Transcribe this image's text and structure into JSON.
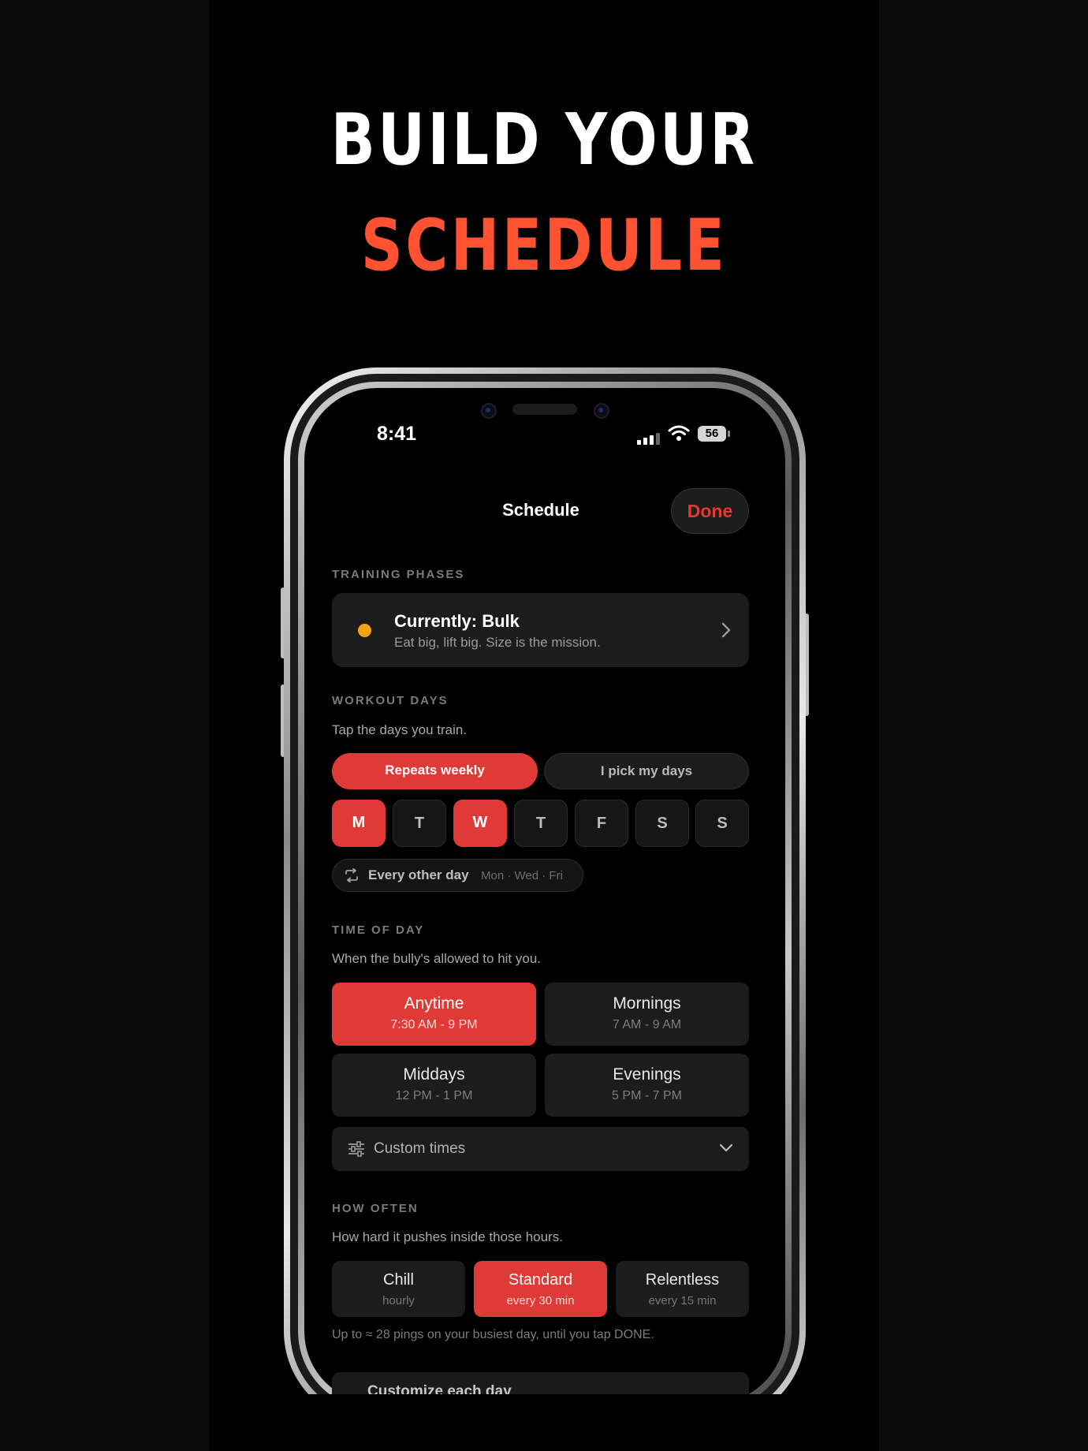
{
  "headline": {
    "line1": "BUILD YOUR",
    "line2": "SCHEDULE"
  },
  "status_bar": {
    "time": "8:41",
    "battery": "56"
  },
  "nav": {
    "title": "Schedule",
    "done_label": "Done"
  },
  "training_phases": {
    "label": "TRAINING PHASES",
    "title": "Currently: Bulk",
    "description": "Eat big, lift big. Size is the mission."
  },
  "workout_days": {
    "label": "WORKOUT DAYS",
    "subtitle": "Tap the days you train.",
    "mode_options": [
      "Repeats weekly",
      "I pick my days"
    ],
    "selected_mode": "Repeats weekly",
    "days": [
      {
        "letter": "M",
        "selected": true
      },
      {
        "letter": "T",
        "selected": false
      },
      {
        "letter": "W",
        "selected": true
      },
      {
        "letter": "T",
        "selected": false
      },
      {
        "letter": "F",
        "selected": false
      },
      {
        "letter": "S",
        "selected": false
      },
      {
        "letter": "S",
        "selected": false
      }
    ],
    "preset_label": "Every other day",
    "preset_days": "Mon · Wed · Fri"
  },
  "time_of_day": {
    "label": "TIME OF DAY",
    "subtitle": "When the bully's allowed to hit you.",
    "options": [
      {
        "label": "Anytime",
        "range": "7:30 AM - 9 PM",
        "selected": true
      },
      {
        "label": "Mornings",
        "range": "7 AM - 9 AM",
        "selected": false
      },
      {
        "label": "Middays",
        "range": "12 PM - 1 PM",
        "selected": false
      },
      {
        "label": "Evenings",
        "range": "5 PM - 7 PM",
        "selected": false
      }
    ],
    "custom_label": "Custom times"
  },
  "how_often": {
    "label": "HOW OFTEN",
    "subtitle": "How hard it pushes inside those hours.",
    "options": [
      {
        "label": "Chill",
        "interval": "hourly",
        "selected": false
      },
      {
        "label": "Standard",
        "interval": "every 30 min",
        "selected": true
      },
      {
        "label": "Relentless",
        "interval": "every 15 min",
        "selected": false
      }
    ],
    "footnote": "Up to ≈ 28 pings on your busiest day, until you tap DONE."
  },
  "customize": {
    "label": "Customize each day"
  },
  "colors": {
    "accent": "#e03a37",
    "headline_accent": "#ff5233",
    "phase_dot": "#f5a311"
  }
}
